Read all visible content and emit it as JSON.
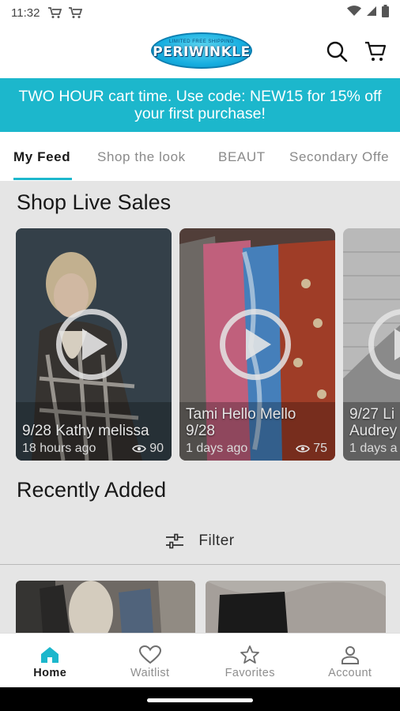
{
  "status_bar": {
    "time": "11:32"
  },
  "header": {
    "logo_top": "LIMITED FREE SHIPPING",
    "logo_text": "PERIWINKLE"
  },
  "promo": {
    "text": "TWO HOUR cart time. Use code: NEW15 for 15% off your first purchase!"
  },
  "tabs": [
    {
      "label": "My Feed",
      "active": true
    },
    {
      "label": "Shop the look",
      "active": false
    },
    {
      "label": "BEAUT",
      "active": false
    },
    {
      "label": "Secondary Offe",
      "active": false
    }
  ],
  "live_sales": {
    "title": "Shop Live Sales",
    "cards": [
      {
        "title": "9/28 Kathy melissa",
        "time": "18 hours ago",
        "views": "90"
      },
      {
        "title": "Tami Hello Mello 9/28",
        "time": "1 days ago",
        "views": "75"
      },
      {
        "title": "9/27 Li Audrey",
        "time": "1 days a",
        "views": ""
      }
    ]
  },
  "recently_added": {
    "title": "Recently Added",
    "filter_label": "Filter"
  },
  "bottom_nav": [
    {
      "label": "Home",
      "icon": "home-icon",
      "active": true
    },
    {
      "label": "Waitlist",
      "icon": "heart-icon",
      "active": false
    },
    {
      "label": "Favorites",
      "icon": "star-icon",
      "active": false
    },
    {
      "label": "Account",
      "icon": "person-icon",
      "active": false
    }
  ],
  "colors": {
    "accent": "#1cb7cc",
    "text": "#1b1b1b",
    "muted": "#8e8e8e"
  }
}
